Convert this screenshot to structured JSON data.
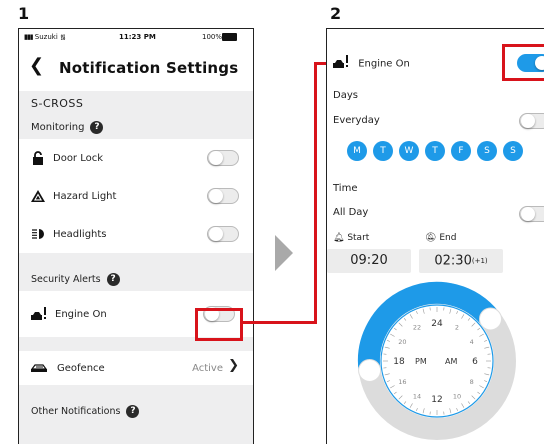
{
  "steps": {
    "one": "1",
    "two": "2"
  },
  "colors": {
    "accent": "#1e9ae8",
    "highlight": "#d8131b",
    "section_bg": "#eeeeef"
  },
  "screen1": {
    "status": {
      "carrier": "Suzuki",
      "time": "11:23 PM",
      "battery": "100%"
    },
    "title": "Notification Settings",
    "vehicle": "S-CROSS",
    "monitoring_label": "Monitoring",
    "items": [
      {
        "label": "Door Lock",
        "icon": "lock-icon",
        "on": false
      },
      {
        "label": "Hazard Light",
        "icon": "hazard-icon",
        "on": false
      },
      {
        "label": "Headlights",
        "icon": "headlight-icon",
        "on": false
      }
    ],
    "security_label": "Security Alerts",
    "engine_on_label": "Engine On",
    "geofence_label": "Geofence",
    "geofence_status": "Active",
    "other_label": "Other Notifications"
  },
  "screen2": {
    "engine_on_label": "Engine On",
    "days_label": "Days",
    "everyday_label": "Everyday",
    "days": [
      "M",
      "T",
      "W",
      "T",
      "F",
      "S",
      "S"
    ],
    "time_label": "Time",
    "all_day_label": "All Day",
    "start_label": "Start",
    "end_label": "End",
    "start_time": "09:20",
    "end_time": "02:30",
    "end_suffix": "(+1)",
    "clock": {
      "numbers": [
        "24",
        "2",
        "4",
        "6",
        "8",
        "10",
        "12",
        "14",
        "16",
        "18",
        "20",
        "22"
      ],
      "pm": "PM",
      "am": "AM"
    }
  }
}
